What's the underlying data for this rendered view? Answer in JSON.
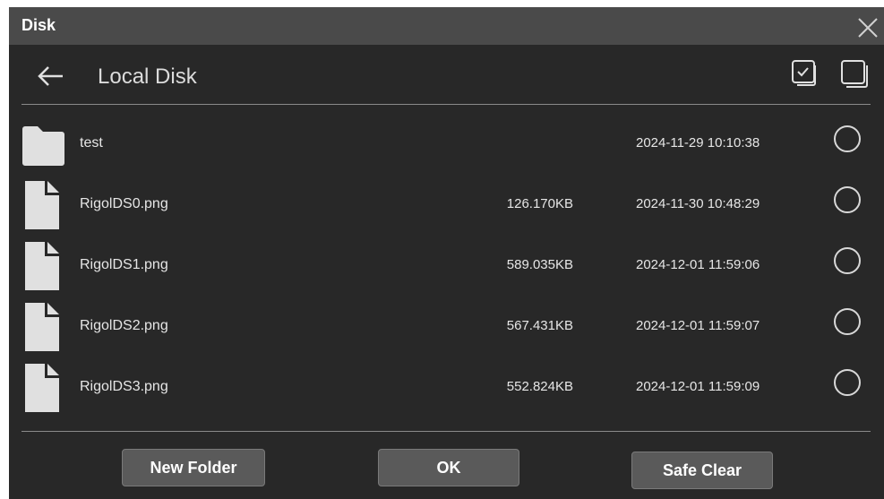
{
  "dialog": {
    "title": "Disk"
  },
  "nav": {
    "title": "Local Disk"
  },
  "files": [
    {
      "name": "test",
      "size": "",
      "date": "2024-11-29 10:10:38",
      "type": "folder",
      "icon": "folder-icon"
    },
    {
      "name": "RigolDS0.png",
      "size": "126.170KB",
      "date": "2024-11-30 10:48:29",
      "type": "file",
      "icon": "file-icon"
    },
    {
      "name": "RigolDS1.png",
      "size": "589.035KB",
      "date": "2024-12-01 11:59:06",
      "type": "file",
      "icon": "file-icon"
    },
    {
      "name": "RigolDS2.png",
      "size": "567.431KB",
      "date": "2024-12-01 11:59:07",
      "type": "file",
      "icon": "file-icon"
    },
    {
      "name": "RigolDS3.png",
      "size": "552.824KB",
      "date": "2024-12-01 11:59:09",
      "type": "file",
      "icon": "file-icon"
    }
  ],
  "footer": {
    "new_folder_label": "New Folder",
    "ok_label": "OK",
    "safe_clear_label": "Safe Clear"
  },
  "icons": {
    "close": "close-icon",
    "back": "back-arrow-icon",
    "select_all": "select-all-icon",
    "deselect_all": "deselect-all-icon"
  },
  "colors": {
    "dialog_bg": "#282828",
    "titlebar_bg": "#4a4a4a",
    "text": "#e6e6e6",
    "icon_fill": "#e0e0e0",
    "button_bg": "#5a5a5a"
  }
}
